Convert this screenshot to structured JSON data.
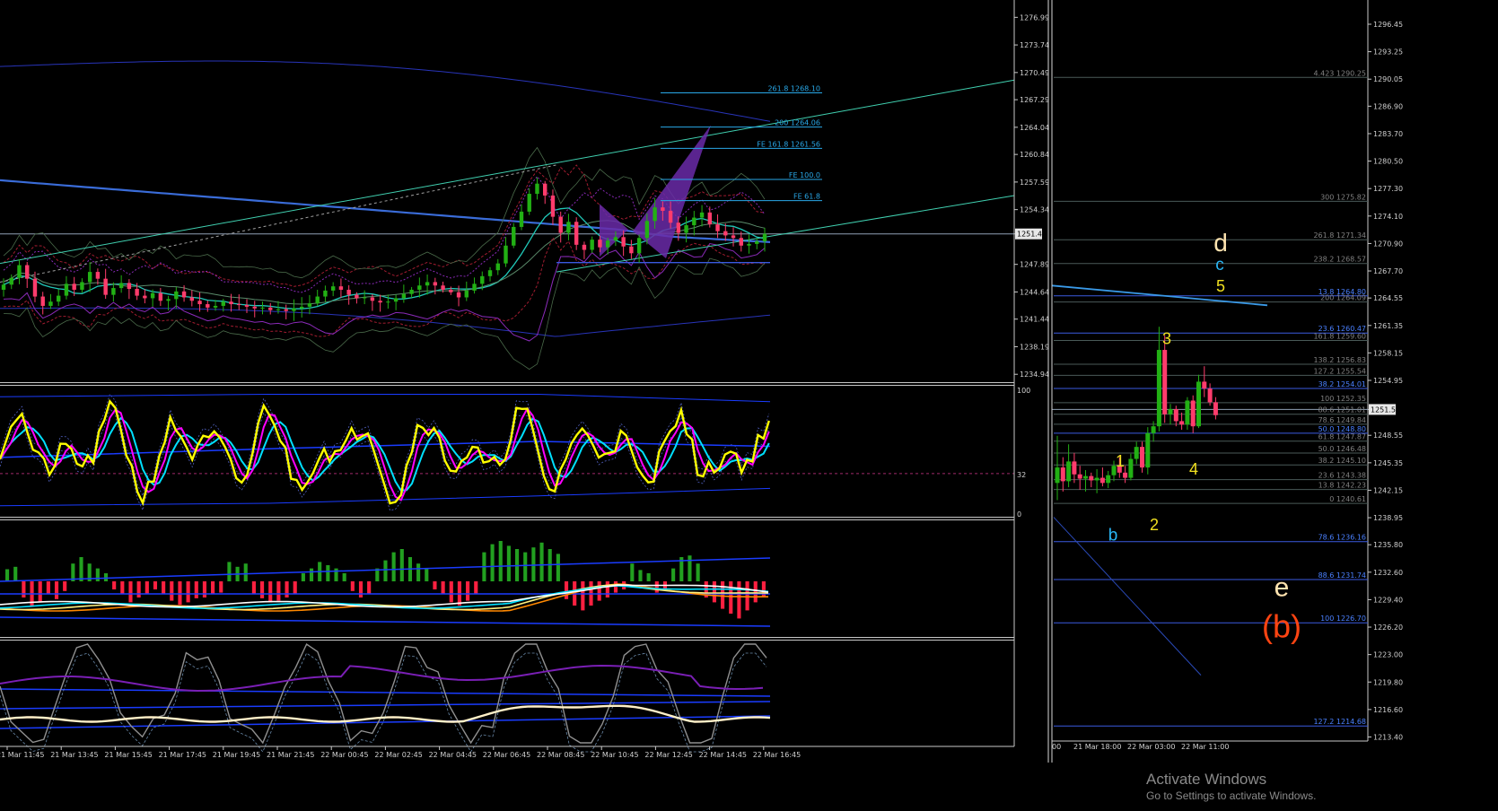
{
  "chart_data": [
    {
      "type": "candlestick",
      "panel": "main",
      "y_axis_ticks": [
        "1276.99",
        "1273.74",
        "1270.49",
        "1267.29",
        "1264.04",
        "1260.84",
        "1257.59",
        "1254.34",
        "1251.48",
        "1247.89",
        "1244.64",
        "1241.44",
        "1238.19",
        "1234.94"
      ],
      "ylim": [
        1233.8,
        1278.4
      ],
      "current_price": 1251.48,
      "x_axis_ticks": [
        "21 Mar 11:45",
        "21 Mar 13:45",
        "21 Mar 15:45",
        "21 Mar 17:45",
        "21 Mar 19:45",
        "21 Mar 21:45",
        "22 Mar 00:45",
        "22 Mar 02:45",
        "22 Mar 04:45",
        "22 Mar 06:45",
        "22 Mar 08:45",
        "22 Mar 10:45",
        "22 Mar 12:45",
        "22 Mar 14:45",
        "22 Mar 16:45"
      ],
      "fib_levels": [
        {
          "label": "261.8 1268.10",
          "value": 1268.1
        },
        {
          "label": "200 1264.06",
          "value": 1264.06
        },
        {
          "label": "FE 161.8 1261.56",
          "value": 1261.56
        },
        {
          "label": "FE 100.0",
          "value": 1257.9
        },
        {
          "label": "FE 61.8",
          "value": 1255.4
        }
      ],
      "candle_colors": {
        "up": "#22b014",
        "down": "#ff3c6c"
      },
      "closes": [
        1245.5,
        1246.3,
        1247.8,
        1246.2,
        1244.1,
        1243.0,
        1243.5,
        1244.2,
        1245.6,
        1244.9,
        1245.8,
        1247.0,
        1246.2,
        1244.3,
        1245.1,
        1245.7,
        1245.0,
        1244.2,
        1243.9,
        1244.5,
        1243.6,
        1243.8,
        1244.7,
        1244.0,
        1243.6,
        1243.2,
        1242.8,
        1243.0,
        1243.5,
        1243.2,
        1243.1,
        1242.9,
        1242.7,
        1242.8,
        1242.5,
        1242.6,
        1242.4,
        1242.7,
        1242.9,
        1243.3,
        1244.1,
        1244.8,
        1245.3,
        1244.9,
        1244.3,
        1243.9,
        1244.0,
        1243.6,
        1243.4,
        1243.5,
        1243.9,
        1244.4,
        1244.9,
        1245.4,
        1245.8,
        1245.4,
        1244.9,
        1244.6,
        1244.0,
        1244.8,
        1245.6,
        1246.5,
        1247.2,
        1248.0,
        1250.1,
        1252.3,
        1254.1,
        1256.2,
        1257.4,
        1256.0,
        1253.5,
        1251.6,
        1252.9,
        1250.2,
        1249.6,
        1250.8,
        1249.9,
        1250.7,
        1251.1,
        1250.0,
        1249.2,
        1251.0,
        1253.0,
        1254.6,
        1254.2,
        1252.8,
        1251.6,
        1252.5,
        1253.4,
        1254.0,
        1252.6,
        1251.8,
        1251.3,
        1251.0,
        1250.1,
        1250.3,
        1250.6,
        1251.48
      ]
    },
    {
      "type": "line",
      "panel": "oscillator",
      "y_axis_ticks": [
        "100",
        "32",
        "0"
      ],
      "ylim": [
        0,
        100
      ],
      "level": 32,
      "series_colors": [
        "#ffff00",
        "#ff00ff",
        "#00e0ff",
        "#1a3cff"
      ]
    },
    {
      "type": "histogram",
      "panel": "macd",
      "colors": {
        "positive": "#22a020",
        "negative": "#ff2040"
      },
      "values": [
        1.5,
        1.8,
        -2.0,
        -3.0,
        -2.6,
        -1.6,
        -2.2,
        -1.2,
        2.2,
        3.0,
        2.2,
        1.6,
        1.0,
        -1.0,
        -1.6,
        -2.6,
        -2.0,
        -1.6,
        -1.0,
        -1.6,
        -2.4,
        -2.9,
        -2.6,
        -2.1,
        -2.0,
        -1.6,
        -1.4,
        2.4,
        1.8,
        2.2,
        -1.6,
        -2.1,
        -2.6,
        -2.4,
        -2.0,
        -1.6,
        1.0,
        1.6,
        2.4,
        2.0,
        1.6,
        1.0,
        -1.2,
        -2.0,
        -1.6,
        1.6,
        2.6,
        3.6,
        4.0,
        3.0,
        2.2,
        1.6,
        -1.0,
        -1.6,
        -2.6,
        -3.0,
        -2.4,
        -1.6,
        3.6,
        4.6,
        5.0,
        4.4,
        4.0,
        3.6,
        4.2,
        4.8,
        4.0,
        3.4,
        -2.2,
        -3.0,
        -3.6,
        -3.0,
        -2.4,
        -2.0,
        -1.4,
        -1.0,
        2.2,
        1.4,
        1.0,
        -1.4,
        -1.0,
        1.6,
        3.0,
        3.2,
        2.2,
        -2.0,
        -2.6,
        -3.4,
        -4.0,
        -4.6,
        -3.6,
        -2.6,
        -2.0
      ]
    },
    {
      "type": "line",
      "panel": "lower",
      "series_colors": [
        "#909090",
        "#7a1fb5",
        "#fff0c8",
        "#1a3cff"
      ]
    },
    {
      "type": "candlestick",
      "panel": "right",
      "y_axis_ticks": [
        "1296.45",
        "1293.25",
        "1290.05",
        "1286.90",
        "1283.70",
        "1280.50",
        "1277.30",
        "1274.10",
        "1270.90",
        "1267.70",
        "1264.55",
        "1261.35",
        "1258.15",
        "1254.95",
        "1251.56",
        "1248.55",
        "1245.35",
        "1242.15",
        "1238.95",
        "1235.80",
        "1232.60",
        "1229.40",
        "1226.20",
        "1223.00",
        "1219.80",
        "1216.60",
        "1213.40"
      ],
      "ylim": [
        1212.3,
        1297.6
      ],
      "current_price": 1251.56,
      "x_axis_ticks": [
        "00",
        "21 Mar 18:00",
        "22 Mar 03:00",
        "22 Mar 11:00"
      ],
      "fib_levels": [
        {
          "label": "4.423 1290.25",
          "value": 1290.25,
          "color": "#707070"
        },
        {
          "label": "300 1275.82",
          "value": 1275.82,
          "color": "#707070"
        },
        {
          "label": "261.8 1271.34",
          "value": 1271.34,
          "color": "#707070"
        },
        {
          "label": "238.2 1268.57",
          "value": 1268.57,
          "color": "#707070"
        },
        {
          "label": "13.8 1264.80",
          "value": 1264.8,
          "color": "#4060ff"
        },
        {
          "label": "200 1264.09",
          "value": 1264.09,
          "color": "#707070"
        },
        {
          "label": "23.6 1260.47",
          "value": 1260.47,
          "color": "#4060ff"
        },
        {
          "label": "161.8 1259.60",
          "value": 1259.6,
          "color": "#707070"
        },
        {
          "label": "138.2 1256.83",
          "value": 1256.83,
          "color": "#707070"
        },
        {
          "label": "127.2 1255.54",
          "value": 1255.54,
          "color": "#707070"
        },
        {
          "label": "38.2 1254.01",
          "value": 1254.01,
          "color": "#4060ff"
        },
        {
          "label": "100 1252.35",
          "value": 1252.35,
          "color": "#707070"
        },
        {
          "label": "88.6 1251.01",
          "value": 1251.01,
          "color": "#707070"
        },
        {
          "label": "78.6 1249.84",
          "value": 1249.84,
          "color": "#707070"
        },
        {
          "label": "50.0 1248.80",
          "value": 1248.8,
          "color": "#4060ff"
        },
        {
          "label": "61.8 1247.87",
          "value": 1247.87,
          "color": "#707070"
        },
        {
          "label": "50.0 1246.48",
          "value": 1246.48,
          "color": "#707070"
        },
        {
          "label": "38.2 1245.10",
          "value": 1245.1,
          "color": "#707070"
        },
        {
          "label": "23.6 1243.38",
          "value": 1243.38,
          "color": "#707070"
        },
        {
          "label": "13.8 1242.23",
          "value": 1242.23,
          "color": "#707070"
        },
        {
          "label": "0 1240.61",
          "value": 1240.61,
          "color": "#707070"
        },
        {
          "label": "78.6 1236.16",
          "value": 1236.16,
          "color": "#4060ff"
        },
        {
          "label": "88.6 1231.74",
          "value": 1231.74,
          "color": "#4060ff"
        },
        {
          "label": "100 1226.70",
          "value": 1226.7,
          "color": "#4060ff"
        },
        {
          "label": "127.2 1214.68",
          "value": 1214.68,
          "color": "#4060ff"
        }
      ],
      "candles": [
        {
          "o": 1243.0,
          "h": 1248.5,
          "l": 1241.0,
          "c": 1244.8
        },
        {
          "o": 1244.8,
          "h": 1246.0,
          "l": 1242.0,
          "c": 1243.2
        },
        {
          "o": 1243.2,
          "h": 1247.5,
          "l": 1242.5,
          "c": 1245.5
        },
        {
          "o": 1245.5,
          "h": 1246.5,
          "l": 1243.0,
          "c": 1244.0
        },
        {
          "o": 1244.0,
          "h": 1245.0,
          "l": 1242.2,
          "c": 1243.5
        },
        {
          "o": 1243.5,
          "h": 1244.5,
          "l": 1242.0,
          "c": 1243.8
        },
        {
          "o": 1243.8,
          "h": 1244.2,
          "l": 1242.5,
          "c": 1243.3
        },
        {
          "o": 1243.3,
          "h": 1244.6,
          "l": 1241.8,
          "c": 1243.6
        },
        {
          "o": 1243.6,
          "h": 1244.8,
          "l": 1242.6,
          "c": 1243.0
        },
        {
          "o": 1243.0,
          "h": 1244.4,
          "l": 1242.4,
          "c": 1243.9
        },
        {
          "o": 1243.9,
          "h": 1245.6,
          "l": 1243.2,
          "c": 1245.0
        },
        {
          "o": 1245.0,
          "h": 1246.0,
          "l": 1243.6,
          "c": 1244.2
        },
        {
          "o": 1244.2,
          "h": 1245.0,
          "l": 1243.0,
          "c": 1243.6
        },
        {
          "o": 1243.6,
          "h": 1246.4,
          "l": 1243.3,
          "c": 1245.8
        },
        {
          "o": 1245.8,
          "h": 1247.8,
          "l": 1245.2,
          "c": 1247.2
        },
        {
          "o": 1247.2,
          "h": 1247.8,
          "l": 1244.2,
          "c": 1244.8
        },
        {
          "o": 1244.8,
          "h": 1249.5,
          "l": 1244.0,
          "c": 1248.8
        },
        {
          "o": 1248.8,
          "h": 1250.2,
          "l": 1247.8,
          "c": 1249.6
        },
        {
          "o": 1249.6,
          "h": 1261.2,
          "l": 1249.0,
          "c": 1258.5
        },
        {
          "o": 1258.5,
          "h": 1260.2,
          "l": 1250.0,
          "c": 1251.0
        },
        {
          "o": 1251.0,
          "h": 1252.2,
          "l": 1249.8,
          "c": 1251.6
        },
        {
          "o": 1251.6,
          "h": 1252.0,
          "l": 1249.6,
          "c": 1250.2
        },
        {
          "o": 1250.2,
          "h": 1251.2,
          "l": 1249.2,
          "c": 1249.8
        },
        {
          "o": 1249.8,
          "h": 1253.0,
          "l": 1249.2,
          "c": 1252.6
        },
        {
          "o": 1252.6,
          "h": 1253.2,
          "l": 1248.8,
          "c": 1249.6
        },
        {
          "o": 1249.6,
          "h": 1255.6,
          "l": 1249.4,
          "c": 1254.8
        },
        {
          "o": 1254.8,
          "h": 1256.6,
          "l": 1253.0,
          "c": 1254.0
        },
        {
          "o": 1254.0,
          "h": 1254.6,
          "l": 1252.0,
          "c": 1252.4
        },
        {
          "o": 1252.4,
          "h": 1253.0,
          "l": 1250.4,
          "c": 1250.9
        }
      ],
      "wave_labels": [
        {
          "text": "d",
          "price": 1270.0,
          "color": "#ffe4b0",
          "size": 28
        },
        {
          "text": "c",
          "price": 1267.8,
          "color": "#29b6f6",
          "size": 19
        },
        {
          "text": "5",
          "price": 1265.3,
          "color": "#f0e020",
          "size": 18
        },
        {
          "text": "3",
          "price": 1259.2,
          "color": "#f0e020",
          "size": 18
        },
        {
          "text": "1",
          "price": 1244.9,
          "color": "#f0e020",
          "size": 18
        },
        {
          "text": "4",
          "price": 1244.0,
          "color": "#f0e020",
          "size": 18
        },
        {
          "text": "2",
          "price": 1237.5,
          "color": "#f0e020",
          "size": 18
        },
        {
          "text": "b",
          "price": 1236.3,
          "color": "#29b6f6",
          "size": 19
        },
        {
          "text": "e",
          "price": 1229.8,
          "color": "#ffe4b0",
          "size": 30
        },
        {
          "text": "(b)",
          "price": 1225.0,
          "color": "#ff4412",
          "size": 36
        }
      ]
    }
  ],
  "watermark": {
    "title": "Activate Windows",
    "subtitle": "Go to Settings to activate Windows."
  }
}
